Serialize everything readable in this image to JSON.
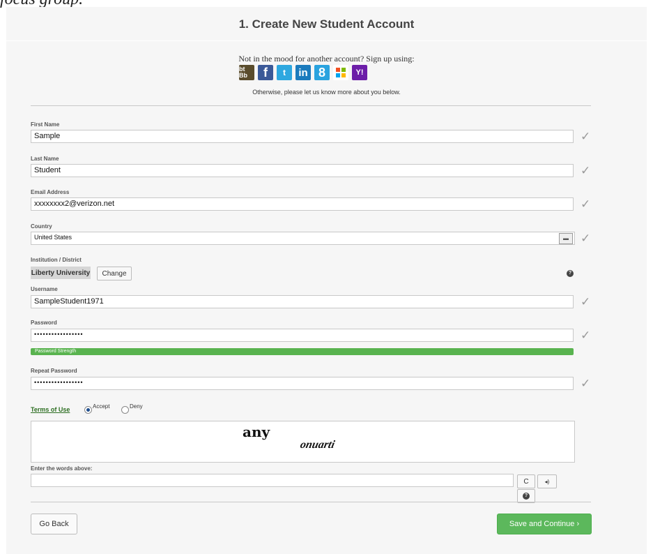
{
  "caption_fragment": "focus group.",
  "title": "1. Create New Student Account",
  "signup": {
    "prompt": "Not in the mood for another account? Sign up using:",
    "providers": [
      {
        "name": "blackboard-icon",
        "glyph": "bt Bb"
      },
      {
        "name": "facebook-icon",
        "glyph": "f"
      },
      {
        "name": "twitter-icon",
        "glyph": "t"
      },
      {
        "name": "linkedin-icon",
        "glyph": "in"
      },
      {
        "name": "google-icon",
        "glyph": "8"
      },
      {
        "name": "windows-icon",
        "glyph": ""
      },
      {
        "name": "yahoo-icon",
        "glyph": "Y!"
      }
    ],
    "otherwise": "Otherwise, please let us know more about you below."
  },
  "fields": {
    "first_name": {
      "label": "First Name",
      "value": "Sample"
    },
    "last_name": {
      "label": "Last Name",
      "value": "Student"
    },
    "email": {
      "label": "Email Address",
      "value": "xxxxxxxx2@verizon.net"
    },
    "country": {
      "label": "Country",
      "value": "United States"
    },
    "institution": {
      "label": "Institution / District",
      "value": "Liberty University",
      "change_label": "Change"
    },
    "username": {
      "label": "Username",
      "value": "SampleStudent1971"
    },
    "password": {
      "label": "Password",
      "value": "•••••••••••••••••",
      "strength_label": "Password Strength"
    },
    "repeat_password": {
      "label": "Repeat Password",
      "value": "•••••••••••••••••"
    }
  },
  "terms": {
    "label": "Terms of Use",
    "accept": "Accept",
    "deny": "Deny",
    "selected": "Accept"
  },
  "captcha": {
    "word1": "any",
    "word2": "onuarti",
    "enter_label": "Enter the words above:",
    "refresh_icon": "C",
    "audio_icon": "◂)",
    "help_icon": "?"
  },
  "actions": {
    "back_label": "Go Back",
    "save_label": "Save and Continue ›"
  },
  "colors": {
    "accent_green": "#5cb85c",
    "terms_green": "#2c6e21"
  }
}
